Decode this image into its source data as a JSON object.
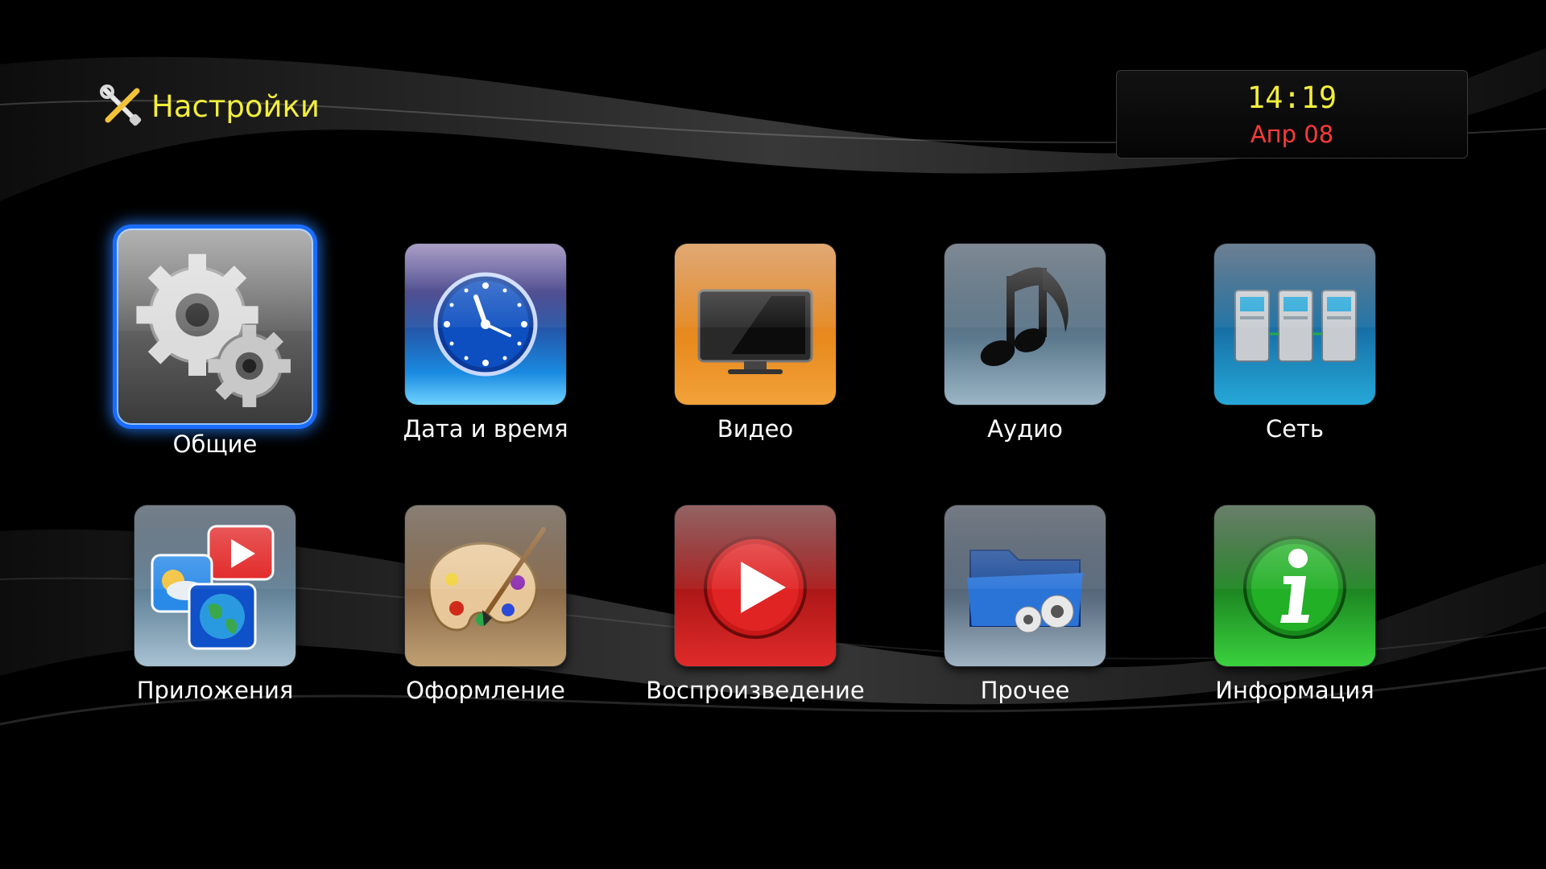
{
  "header": {
    "title": "Настройки",
    "title_icon": "tools-icon"
  },
  "clock": {
    "time": "14:19",
    "date": "Апр 08"
  },
  "colors": {
    "accent": "#f2ee3c",
    "date": "#ff3a3a",
    "selection": "#1a6cff",
    "label": "#ffffff"
  },
  "selected_index": 0,
  "menu": [
    {
      "label": "Общие",
      "icon": "gears-icon",
      "selected": true
    },
    {
      "label": "Дата и время",
      "icon": "clock-icon",
      "selected": false
    },
    {
      "label": "Видео",
      "icon": "tv-icon",
      "selected": false
    },
    {
      "label": "Аудио",
      "icon": "music-note-icon",
      "selected": false
    },
    {
      "label": "Сеть",
      "icon": "network-servers-icon",
      "selected": false
    },
    {
      "label": "Приложения",
      "icon": "apps-icon",
      "selected": false
    },
    {
      "label": "Оформление",
      "icon": "palette-icon",
      "selected": false
    },
    {
      "label": "Воспроизведение",
      "icon": "play-icon",
      "selected": false
    },
    {
      "label": "Прочее",
      "icon": "folder-gears-icon",
      "selected": false
    },
    {
      "label": "Информация",
      "icon": "info-icon",
      "selected": false
    }
  ]
}
